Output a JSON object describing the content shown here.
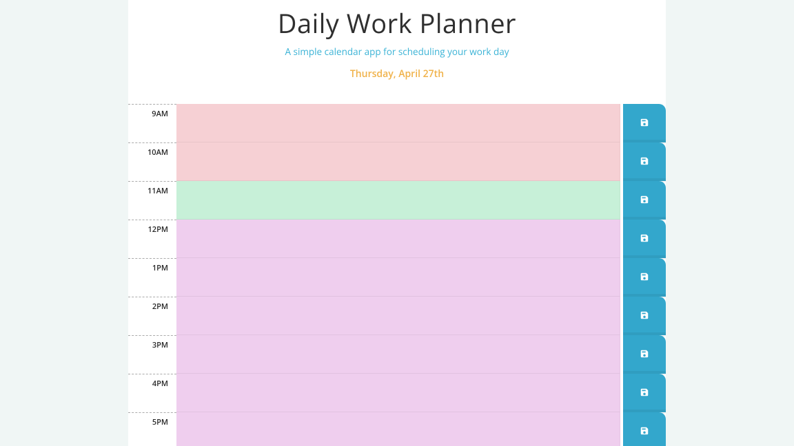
{
  "header": {
    "title": "Daily Work Planner",
    "subtitle": "A simple calendar app for scheduling your work day",
    "date": "Thursday, April 27th"
  },
  "colors": {
    "accent": "#33a7cc",
    "past": "#f6d0d4",
    "present": "#c7f0d8",
    "future": "#efceee",
    "date": "#f0b24a"
  },
  "planner": {
    "slots": [
      {
        "hour_label": "9AM",
        "state": "past",
        "task": ""
      },
      {
        "hour_label": "10AM",
        "state": "past",
        "task": ""
      },
      {
        "hour_label": "11AM",
        "state": "present",
        "task": ""
      },
      {
        "hour_label": "12PM",
        "state": "future",
        "task": ""
      },
      {
        "hour_label": "1PM",
        "state": "future",
        "task": ""
      },
      {
        "hour_label": "2PM",
        "state": "future",
        "task": ""
      },
      {
        "hour_label": "3PM",
        "state": "future",
        "task": ""
      },
      {
        "hour_label": "4PM",
        "state": "future",
        "task": ""
      },
      {
        "hour_label": "5PM",
        "state": "future",
        "task": ""
      }
    ],
    "save_icon": "save-icon"
  }
}
